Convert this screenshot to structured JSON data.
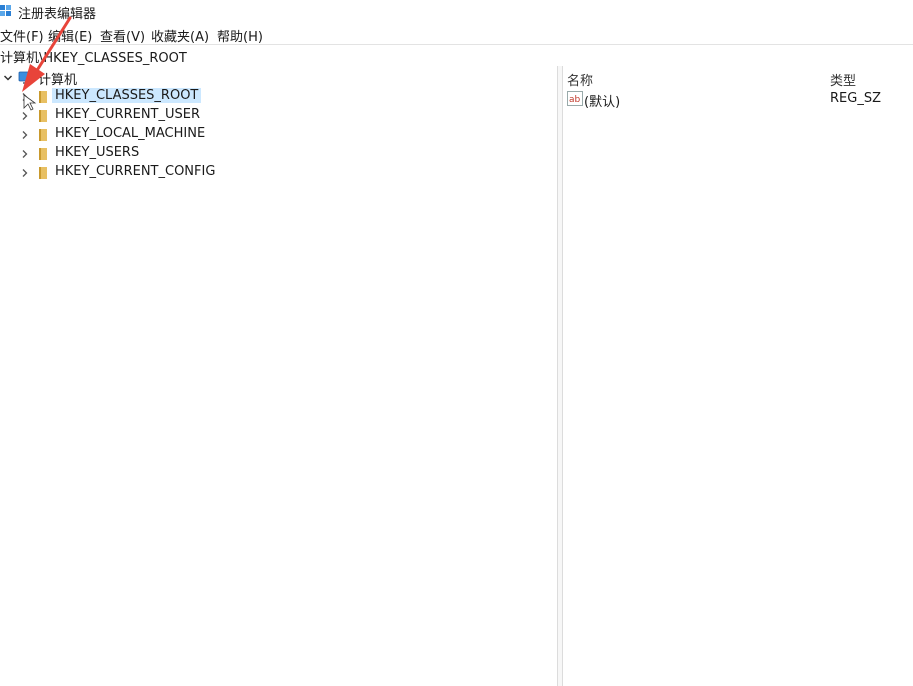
{
  "window": {
    "title": "注册表编辑器"
  },
  "menu": [
    "文件(F)",
    "编辑(E)",
    "查看(V)",
    "收藏夹(A)",
    "帮助(H)"
  ],
  "address": "计算机\\HKEY_CLASSES_ROOT",
  "tree": {
    "root": "计算机",
    "items": [
      {
        "label": "HKEY_CLASSES_ROOT",
        "selected": true
      },
      {
        "label": "HKEY_CURRENT_USER",
        "selected": false
      },
      {
        "label": "HKEY_LOCAL_MACHINE",
        "selected": false
      },
      {
        "label": "HKEY_USERS",
        "selected": false
      },
      {
        "label": "HKEY_CURRENT_CONFIG",
        "selected": false
      }
    ]
  },
  "list": {
    "columns": {
      "name": "名称",
      "type": "类型"
    },
    "rows": [
      {
        "name": "(默认)",
        "type": "REG_SZ",
        "icon": "string-value-icon"
      }
    ]
  },
  "colors": {
    "selection": "#cce8ff",
    "folder": "#e8c063",
    "annotation_arrow": "#e8443a"
  }
}
